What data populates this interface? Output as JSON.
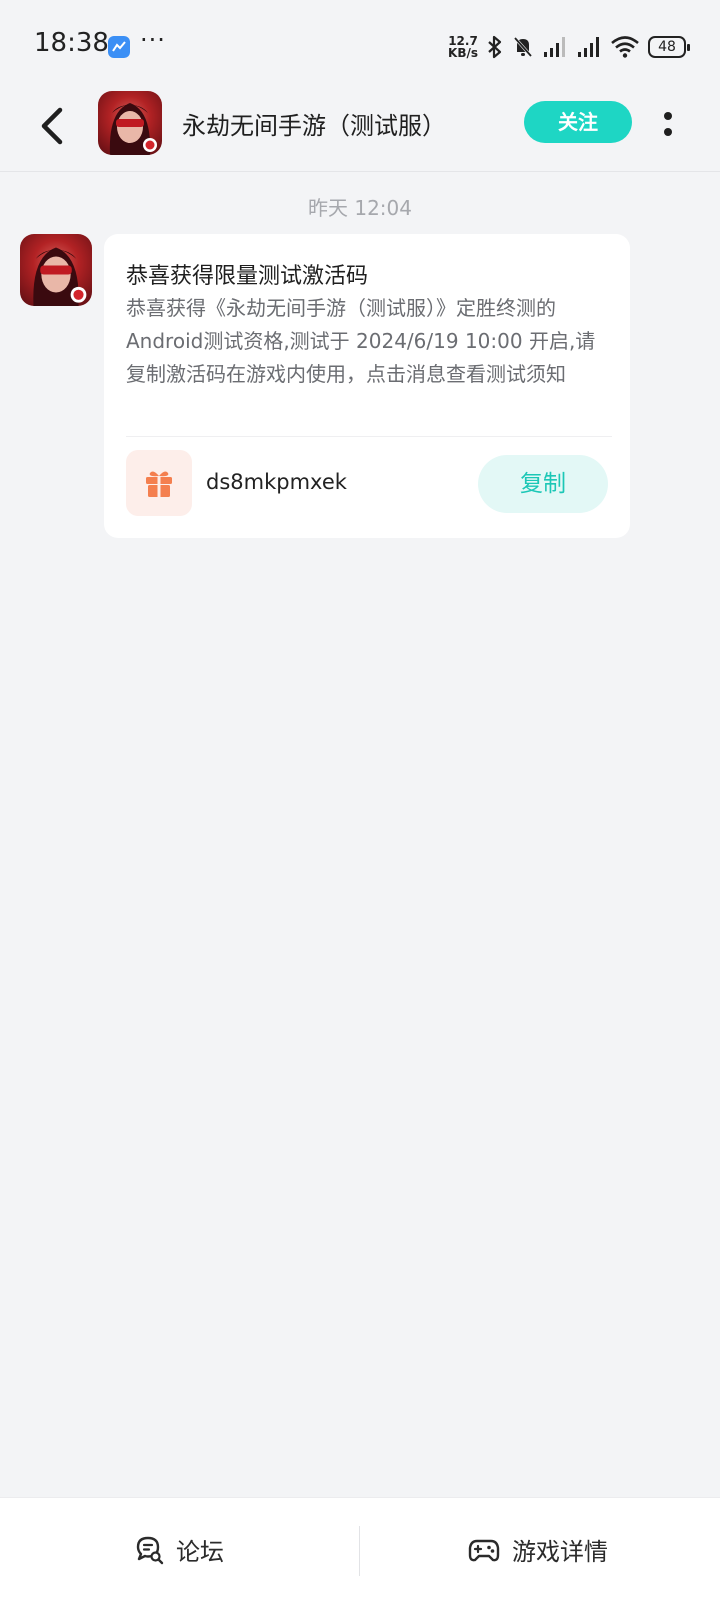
{
  "status_bar": {
    "time": "18:38",
    "dots": "···",
    "net_speed_value": "12.7",
    "net_speed_unit": "KB/s",
    "battery": "48"
  },
  "header": {
    "title": "永劫无间手游（测试服）",
    "follow_label": "关注"
  },
  "chat": {
    "timestamp": "昨天  12:04",
    "message": {
      "title": "恭喜获得限量测试激活码",
      "body": "恭喜获得《永劫无间手游（测试服）》定胜终测的Android测试资格,测试于 2024/6/19 10:00 开启,请复制激活码在游戏内使用，点击消息查看测试须知",
      "code": "ds8mkpmxek",
      "copy_label": "复制"
    }
  },
  "bottom_bar": {
    "forum_label": "论坛",
    "details_label": "游戏详情"
  },
  "colors": {
    "accent": "#1ed6c4",
    "background": "#f3f4f6",
    "gift": "#f47f4f"
  }
}
